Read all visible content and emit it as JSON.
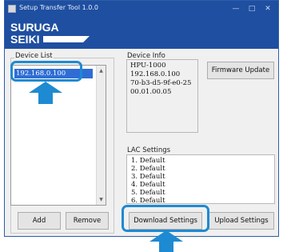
{
  "window": {
    "title": "Setup Transfer Tool 1.0.0",
    "controls": {
      "minimize": "—",
      "maximize": "□",
      "close": "✕"
    }
  },
  "brand": {
    "line1": "SURUGA",
    "line2": "SEIKI",
    "colors": {
      "banner": "#1f4fa0",
      "logo_text": "#ffffff"
    }
  },
  "device_list": {
    "label": "Device List",
    "items": [
      "192.168.0.100"
    ],
    "selected_index": 0,
    "add_label": "Add",
    "remove_label": "Remove"
  },
  "device_info": {
    "label": "Device Info",
    "lines": [
      "HPU-1000",
      "192.168.0.100",
      "70-b3-d5-9f-e0-25",
      "00.01.00.05"
    ]
  },
  "firmware_update_label": "Firmware Update",
  "lac_settings": {
    "label": "LAC Settings",
    "items": [
      "1. Default",
      "2. Default",
      "3. Default",
      "4. Default",
      "5. Default",
      "6. Default"
    ]
  },
  "download_settings_label": "Download Settings",
  "upload_settings_label": "Upload Settings",
  "annotation": {
    "highlight_color": "#1e8ad2",
    "arrow_color": "#1e8ad2"
  },
  "icons": [
    "app-icon",
    "minimize-icon",
    "maximize-icon",
    "close-icon",
    "scroll-up-icon",
    "scroll-down-icon",
    "arrow-up-icon"
  ]
}
